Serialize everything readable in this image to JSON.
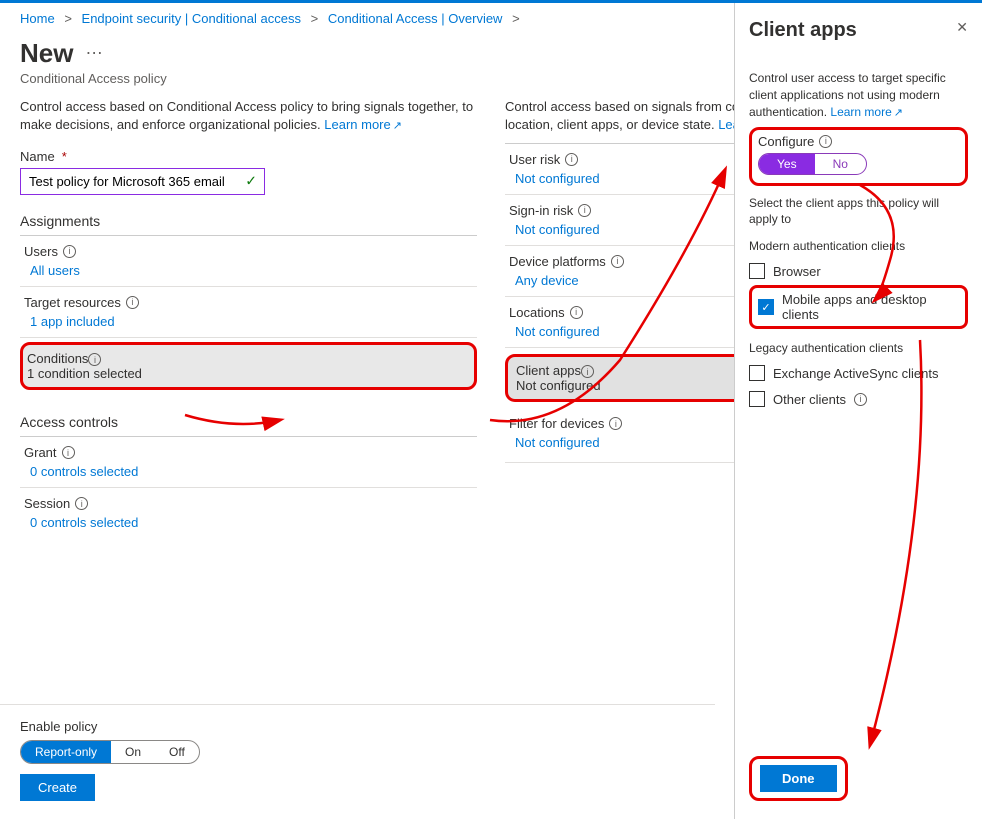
{
  "breadcrumb": {
    "home": "Home",
    "b1": "Endpoint security | Conditional access",
    "b2": "Conditional Access | Overview"
  },
  "header": {
    "title": "New",
    "subtitle": "Conditional Access policy"
  },
  "col1": {
    "intro": "Control access based on Conditional Access policy to bring signals together, to make decisions, and enforce organizational policies.",
    "learn_more": "Learn more",
    "name_label": "Name",
    "name_value": "Test policy for Microsoft 365 email",
    "assignments_head": "Assignments",
    "users_label": "Users",
    "users_value": "All users",
    "target_label": "Target resources",
    "target_value": "1 app included",
    "conditions_label": "Conditions",
    "conditions_value": "1 condition selected",
    "access_head": "Access controls",
    "grant_label": "Grant",
    "grant_value": "0 controls selected",
    "session_label": "Session",
    "session_value": "0 controls selected"
  },
  "col2": {
    "intro": "Control access based on signals from conditions like risk, device platform, location, client apps, or device state.",
    "learn_more": "Learn more",
    "user_risk": "User risk",
    "user_risk_v": "Not configured",
    "signin_risk": "Sign-in risk",
    "signin_risk_v": "Not configured",
    "dev_plat": "Device platforms",
    "dev_plat_v": "Any device",
    "locations": "Locations",
    "locations_v": "Not configured",
    "client_apps": "Client apps",
    "client_apps_v": "Not configured",
    "filter": "Filter for devices",
    "filter_v": "Not configured"
  },
  "footer": {
    "enable_label": "Enable policy",
    "opt1": "Report-only",
    "opt2": "On",
    "opt3": "Off",
    "create": "Create"
  },
  "panel": {
    "title": "Client apps",
    "intro": "Control user access to target specific client applications not using modern authentication.",
    "learn_more": "Learn more",
    "configure": "Configure",
    "yes": "Yes",
    "no": "No",
    "select_text": "Select the client apps this policy will apply to",
    "group1": "Modern authentication clients",
    "cb_browser": "Browser",
    "cb_mobile": "Mobile apps and desktop clients",
    "group2": "Legacy authentication clients",
    "cb_eas": "Exchange ActiveSync clients",
    "cb_other": "Other clients",
    "done": "Done"
  }
}
